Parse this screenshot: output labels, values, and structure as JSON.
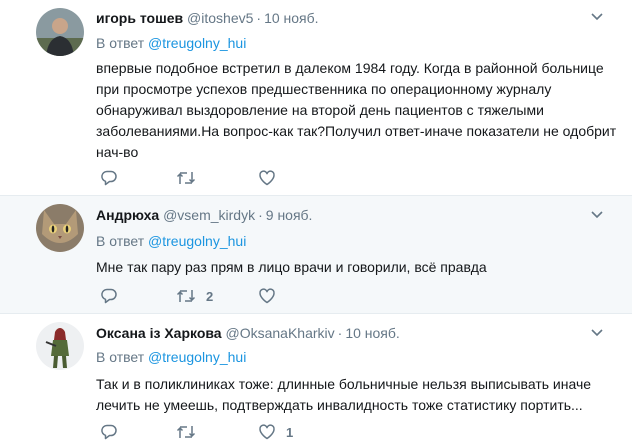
{
  "tweets": [
    {
      "name": "игорь тошев",
      "handle": "@itoshev5",
      "time": "10 нояб.",
      "reply_prefix": "В ответ ",
      "reply_to": "@treugolny_hui",
      "text": "впервые подобное встретил в далеком 1984 году. Когда в районной больнице при просмотре успехов предшественника по операционному журналу обнаруживал выздоровление на второй день пациентов с тяжелыми заболеваниями.На вопрос-как так?Получил ответ-иначе показатели не одобрит нач-во",
      "retweets": "",
      "likes": ""
    },
    {
      "name": "Андрюха",
      "handle": "@vsem_kirdyk",
      "time": "9 нояб.",
      "reply_prefix": "В ответ ",
      "reply_to": "@treugolny_hui",
      "text": "Мне так пару раз прям в лицо врачи и говорили, всё правда",
      "retweets": "2",
      "likes": ""
    },
    {
      "name": "Оксана із Харкова",
      "handle": "@OksanaKharkiv",
      "time": "10 нояб.",
      "reply_prefix": "В ответ ",
      "reply_to": "@treugolny_hui",
      "text": "Так и в поликлиниках тоже: длинные больничные нельзя выписывать иначе лечить не умеешь, подтверждать инвалидность тоже статистику портить...",
      "retweets": "",
      "likes": "1"
    }
  ],
  "separator": "·",
  "colors": {
    "link": "#1b95e0",
    "muted": "#657786",
    "text": "#14171a",
    "border": "#e6ecf0",
    "hover_bg": "#f5f8fa"
  },
  "icons": {
    "reply": "reply-icon",
    "retweet": "retweet-icon",
    "like": "heart-icon",
    "menu": "chevron-down-icon"
  }
}
